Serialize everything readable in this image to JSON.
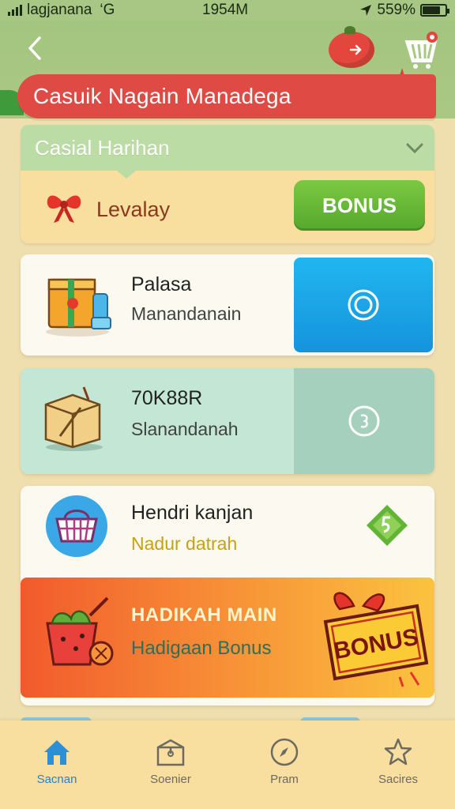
{
  "status_bar": {
    "carrier": "lagjanana",
    "network": "‘G",
    "time": "1954M",
    "battery": "559%",
    "battery_level": 0.8
  },
  "header": {
    "banner_title": "Casuik Nagain Manadega"
  },
  "daily_card": {
    "title": "Casial Harihan",
    "label": "Levalay",
    "button_label": "BONUS"
  },
  "list": [
    {
      "title": "Palasa",
      "subtitle": "Manandanain",
      "icon": "box-gift-icon",
      "action_icon": "target-icon",
      "action_color": "#1aa6e8"
    },
    {
      "title": "70K88R",
      "subtitle": "Slanandanah",
      "icon": "parcel-icon",
      "action_icon": "coin-icon",
      "action_color": "#a5d0be"
    },
    {
      "title": "Hendri kanjan",
      "subtitle": "Nadur datrah",
      "icon": "basket-icon",
      "action_icon": "diamond-icon"
    }
  ],
  "promo": {
    "title": "HADIKAH MAIN",
    "subtitle": "Hadigaan Bonus",
    "ticket_text": "BONUS"
  },
  "tabs": [
    {
      "label": "Sacnan",
      "icon": "home-icon",
      "active": true
    },
    {
      "label": "Soenier",
      "icon": "box-icon",
      "active": false
    },
    {
      "label": "Pram",
      "icon": "compass-icon",
      "active": false
    },
    {
      "label": "Sacires",
      "icon": "star-icon",
      "active": false
    }
  ],
  "colors": {
    "background": "#efdfae",
    "header_green": "#a9c784",
    "banner_red": "#e04a44",
    "bonus_green": "#62b436",
    "accent_blue": "#1aa6e8",
    "tab_active": "#2d7ec1"
  }
}
